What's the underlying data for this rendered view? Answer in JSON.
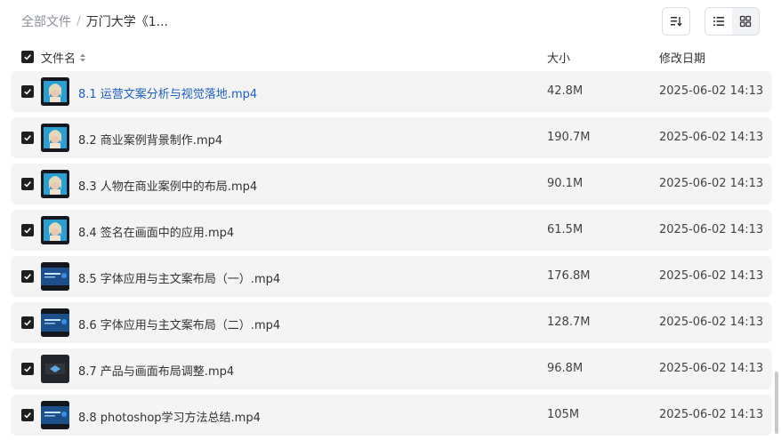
{
  "breadcrumb": {
    "root": "全部文件",
    "separator": "/",
    "current": "万门大学《1..."
  },
  "toolbar": {
    "sort_icon": "sort-lines-icon",
    "list_view_icon": "list-view-icon",
    "grid_view_icon": "grid-view-icon",
    "active_view": "list"
  },
  "table": {
    "headers": {
      "name": "文件名",
      "size": "大小",
      "modified": "修改日期"
    },
    "rows": [
      {
        "name": "8.1 运营文案分析与视觉落地.mp4",
        "size": "42.8M",
        "modified": "2025-06-02 14:13",
        "thumb": "portrait",
        "highlighted": true
      },
      {
        "name": "8.2 商业案例背景制作.mp4",
        "size": "190.7M",
        "modified": "2025-06-02 14:13",
        "thumb": "portrait",
        "highlighted": false
      },
      {
        "name": "8.3 人物在商业案例中的布局.mp4",
        "size": "90.1M",
        "modified": "2025-06-02 14:13",
        "thumb": "portrait",
        "highlighted": false
      },
      {
        "name": "8.4 签名在画面中的应用.mp4",
        "size": "61.5M",
        "modified": "2025-06-02 14:13",
        "thumb": "portrait",
        "highlighted": false
      },
      {
        "name": "8.5 字体应用与主文案布局（一）.mp4",
        "size": "176.8M",
        "modified": "2025-06-02 14:13",
        "thumb": "banner",
        "highlighted": false
      },
      {
        "name": "8.6 字体应用与主文案布局（二）.mp4",
        "size": "128.7M",
        "modified": "2025-06-02 14:13",
        "thumb": "banner",
        "highlighted": false
      },
      {
        "name": "8.7 产品与画面布局调整.mp4",
        "size": "96.8M",
        "modified": "2025-06-02 14:13",
        "thumb": "dark",
        "highlighted": false
      },
      {
        "name": "8.8 photoshop学习方法总结.mp4",
        "size": "105M",
        "modified": "2025-06-02 14:13",
        "thumb": "banner",
        "highlighted": false
      }
    ]
  },
  "colors": {
    "link": "#1b5fc4",
    "row_bg": "#f4f4f5",
    "checkbox": "#1f1f1f"
  }
}
